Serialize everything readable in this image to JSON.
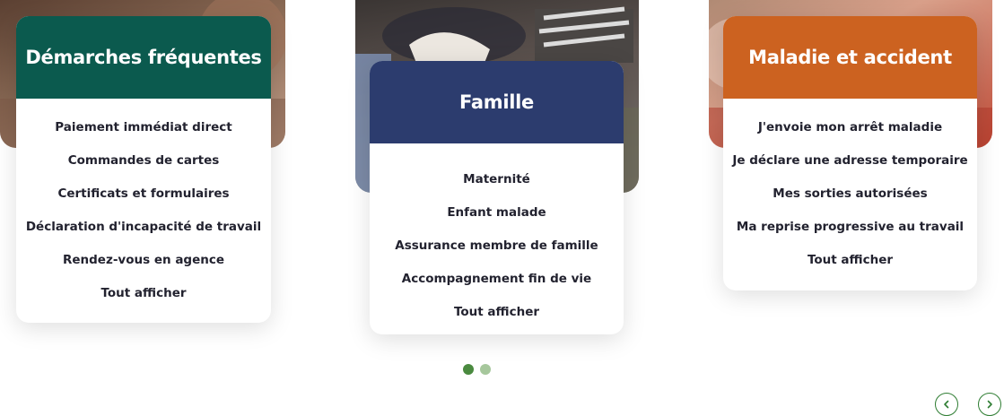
{
  "colors": {
    "demarches": "#0b5a4e",
    "famille": "#2c3c6e",
    "maladie": "#cc6220",
    "dot_active": "#4a8a3f",
    "dot_inactive": "#a6c79c"
  },
  "cards": [
    {
      "title": "Démarches fréquentes",
      "links": [
        "Paiement immédiat direct",
        "Commandes de cartes",
        "Certificats et formulaires",
        "Déclaration d'incapacité de travail",
        "Rendez-vous en agence",
        "Tout afficher"
      ]
    },
    {
      "title": "Famille",
      "links": [
        "Maternité",
        "Enfant malade",
        "Assurance membre de famille",
        "Accompagnement fin de vie",
        "Tout afficher"
      ]
    },
    {
      "title": "Maladie et accident",
      "links": [
        "J'envoie mon arrêt maladie",
        "Je déclare une adresse temporaire",
        "Mes sorties autorisées",
        "Ma reprise progressive au travail",
        "Tout afficher"
      ]
    }
  ],
  "carousel": {
    "active_index": 0,
    "page_count": 2,
    "prev_icon": "chevron-left-icon",
    "next_icon": "chevron-right-icon"
  }
}
